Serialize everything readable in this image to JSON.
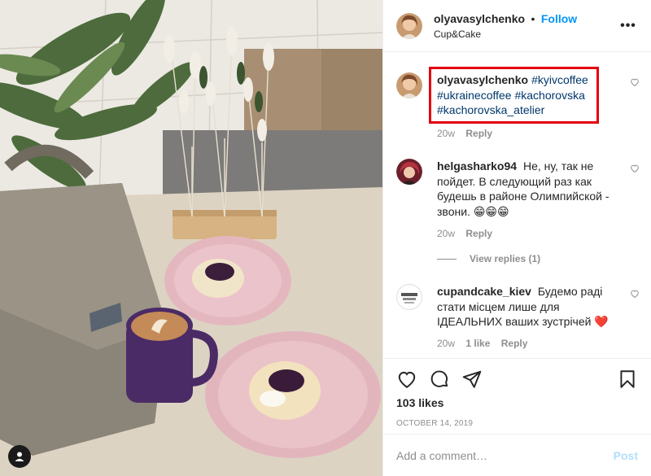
{
  "post": {
    "author": "olyavasylchenko",
    "follow_label": "Follow",
    "dot": "•",
    "location": "Cup&Cake",
    "more_label": "•••",
    "likes": "103 likes",
    "date": "OCTOBER 14, 2019"
  },
  "caption": {
    "username": "olyavasylchenko",
    "hashtags": [
      "#kyivcoffee",
      "#ukrainecoffee",
      "#kachorovska",
      "#kachorovska_atelier"
    ],
    "age": "20w",
    "reply_label": "Reply"
  },
  "comments": [
    {
      "username": "helgasharko94",
      "text": "Не, ну, так не пойдет. В следующий раз как будешь в районе Олимпийской - звони. 😁😁😁",
      "age": "20w",
      "reply_label": "Reply",
      "view_replies": "View replies (1)"
    },
    {
      "username": "cupandcake_kiev",
      "text": "Будемо раді стати місцем лише для ІДЕАЛЬНИХ ваших зустрічей ❤️",
      "age": "20w",
      "likes": "1 like",
      "reply_label": "Reply"
    }
  ],
  "composer": {
    "placeholder": "Add a comment…",
    "post_label": "Post"
  },
  "icons": {
    "like": "heart-icon",
    "comment": "comment-bubble-icon",
    "share": "paper-plane-icon",
    "save": "bookmark-icon",
    "comment_like": "heart-icon",
    "user_tags": "user-icon"
  },
  "colors": {
    "link_blue": "#0095f6",
    "hashtag": "#00376b",
    "highlight_box": "#e3000f",
    "muted": "#8e8e8e",
    "post_disabled": "#b2dffc"
  }
}
